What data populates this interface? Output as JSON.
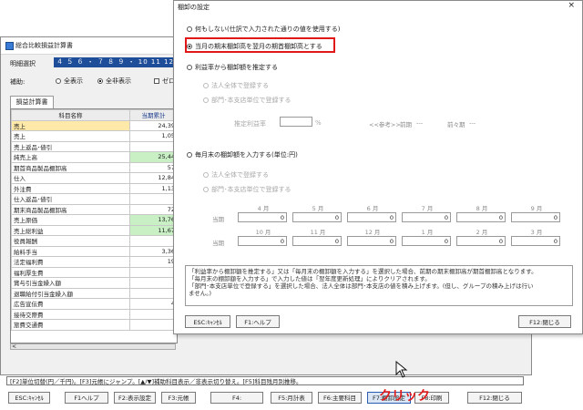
{
  "main_window": {
    "title": "総合比較損益計算書",
    "period_label": "明細選択",
    "period_months": "４ ５ ６ ・ ７ ８ ９ ・ 10 11 12 ・ 1",
    "hojo_label": "補助:",
    "options": [
      "全表示",
      "全非表示",
      "ゼロ"
    ],
    "sheet_tab": "損益計算書",
    "table": {
      "headers": [
        "科目名称",
        "当期累計"
      ],
      "rows": [
        {
          "name": "売上",
          "value": "24,39",
          "style": "hl"
        },
        {
          "name": "売上",
          "value": "1,05",
          "style": ""
        },
        {
          "name": "売上返品･値引",
          "value": "",
          "style": ""
        },
        {
          "name": "純売上高",
          "value": "25,44",
          "style": "green"
        },
        {
          "name": "期首商品製品棚卸高",
          "value": "57",
          "style": ""
        },
        {
          "name": "仕入",
          "value": "12,84",
          "style": ""
        },
        {
          "name": "外注費",
          "value": "1,13",
          "style": ""
        },
        {
          "name": "仕入返品･値引",
          "value": "",
          "style": ""
        },
        {
          "name": "期末商品製品棚卸高",
          "value": "72",
          "style": ""
        },
        {
          "name": "売上原価",
          "value": "13,76",
          "style": "green"
        },
        {
          "name": "売上総利益",
          "value": "11,67",
          "style": "green"
        },
        {
          "name": "役員報酬",
          "value": "",
          "style": ""
        },
        {
          "name": "給料手当",
          "value": "3,36",
          "style": ""
        },
        {
          "name": "法定福利費",
          "value": "19",
          "style": ""
        },
        {
          "name": "福利厚生費",
          "value": "",
          "style": ""
        },
        {
          "name": "賞与引当金繰入額",
          "value": "",
          "style": ""
        },
        {
          "name": "退職給付引当金繰入額",
          "value": "",
          "style": ""
        },
        {
          "name": "広告宣伝費",
          "value": "4",
          "style": ""
        },
        {
          "name": "接待交際費",
          "value": "",
          "style": ""
        },
        {
          "name": "旅費交通費",
          "value": "",
          "style": ""
        }
      ]
    },
    "status_text": "[F2]単位切替(円／千円)。[F3]元帳にジャンプ。[▲/▼]補助科目表示／非表示切り替え。[F5]科目残月別推移。",
    "fkeys": [
      "ESC:ｷｬﾝｾﾙ",
      "F1ヘルプ",
      "F2:表示設定",
      "F3:元帳",
      "F4:",
      "F5:月計表",
      "F6:主要科目",
      "F7:棚卸設定",
      "F8:印刷",
      "F12:閉じる"
    ]
  },
  "dialog": {
    "title": "棚卸の設定",
    "close_glyph": "×",
    "option_none": "何もしない(仕訳で入力された通りの値を使用する)",
    "option_prev_month": "当月の期末棚卸高を翌月の期首棚卸高とする",
    "option_rate": "利益率から棚卸額を推定する",
    "sub_corp": "法人全体で登録する",
    "sub_branch": "部門･本支店単位で登録する",
    "rate_label": "推定利益率",
    "rate_value": "",
    "rate_unit": "%",
    "ref_label": "<<参考>>",
    "ref_prev": "前期",
    "ref_prev_value": "---",
    "ref_prev2": "前々期",
    "ref_prev2_value": "---",
    "option_monthly": "毎月末の棚卸額を入力する(単位:円)",
    "sub_corp2": "法人全体で登録する",
    "sub_branch2": "部門･本支店単位で登録する",
    "row_label": "当期",
    "months_row1": [
      "4 月",
      "5 月",
      "6 月",
      "7 月",
      "8 月",
      "9 月"
    ],
    "months_row2": [
      "10 月",
      "11 月",
      "12 月",
      "1 月",
      "2 月",
      "3 月"
    ],
    "values_row1": [
      "0",
      "0",
      "0",
      "0",
      "0",
      "0"
    ],
    "values_row2": [
      "0",
      "0",
      "0",
      "0",
      "0",
      "0"
    ],
    "note_lines": [
      "「利益率から棚卸額を推定する」又は「毎月末の棚卸額を入力する」を選択した場合、前期の期末棚卸高が期首棚卸高となります。",
      "「毎月末の棚卸額を入力する」で入力した値は「翌年度更新処理」によりクリアされます。",
      "「部門･本支店単位で登録する」を選択した場合、法人全体は部門･本支店の値を積み上げます。(但し、グループの積み上げは行い",
      "ません。)"
    ],
    "btn_esc": "ESC:ｷｬﾝｾﾙ",
    "btn_help": "F1:ヘルプ",
    "btn_close": "F12:閉じる"
  },
  "annotation": {
    "click_text": "クリック",
    "highlight_color": "#e01818"
  }
}
